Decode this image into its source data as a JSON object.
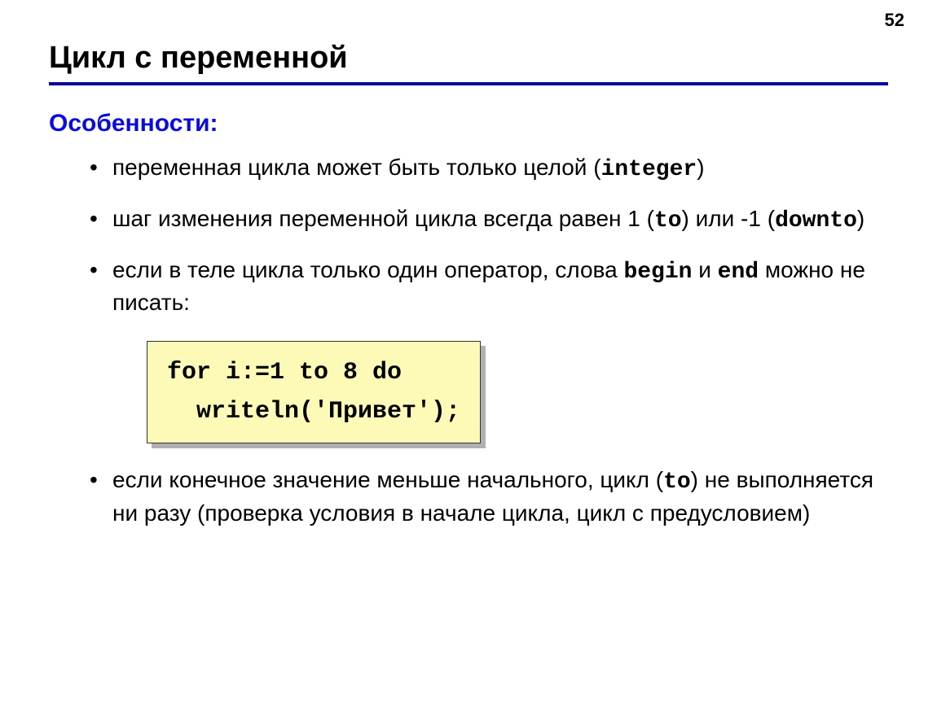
{
  "page_number": "52",
  "title": "Цикл с переменной",
  "subhead": "Особенности:",
  "bullets": [
    {
      "pre1": "переменная цикла может быть только целой (",
      "code1": "integer",
      "post1": ")"
    },
    {
      "pre1": "шаг изменения переменной цикла всегда равен 1 (",
      "code1": "to",
      "mid1": ") или -1 (",
      "code2": "downto",
      "post1": ")"
    },
    {
      "pre1": "если в теле цикла только один оператор, слова ",
      "code1": "begin",
      "mid1": " и ",
      "code2": "end",
      "post1": " можно не писать:"
    },
    {
      "pre1": "если конечное значение меньше начального, цикл (",
      "code1": "to",
      "post1": ") не выполняется ни разу (проверка условия в начале цикла, цикл с предусловием)"
    }
  ],
  "code_block": "for i:=1 to 8 do\n  writeln('Привет');"
}
